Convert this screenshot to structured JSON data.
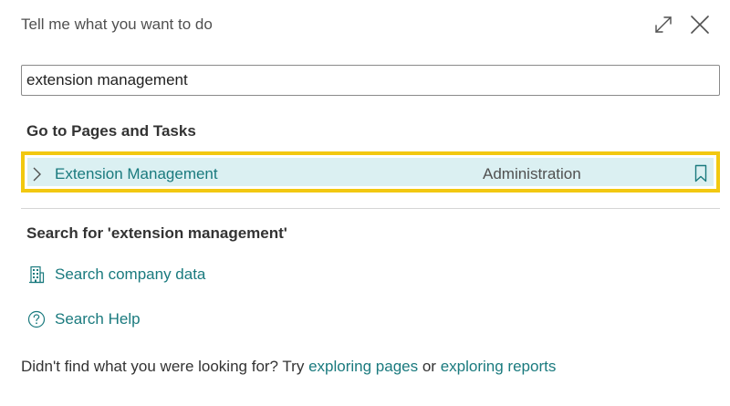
{
  "dialog": {
    "title": "Tell me what you want to do"
  },
  "search": {
    "value": "extension management"
  },
  "pages_tasks": {
    "heading": "Go to Pages and Tasks",
    "results": [
      {
        "label": "Extension Management",
        "category": "Administration"
      }
    ]
  },
  "search_for": {
    "heading": "Search for 'extension management'",
    "actions": [
      {
        "label": "Search company data",
        "icon": "building-icon"
      },
      {
        "label": "Search Help",
        "icon": "help-circle-icon"
      }
    ]
  },
  "footer": {
    "prefix": "Didn't find what you were looking for? Try",
    "link1": "exploring pages",
    "middle": "or",
    "link2": "exploring reports"
  },
  "colors": {
    "accent": "#1a7a7e",
    "highlight_border": "#f2c811",
    "selected_bg": "#dbf0f2"
  }
}
